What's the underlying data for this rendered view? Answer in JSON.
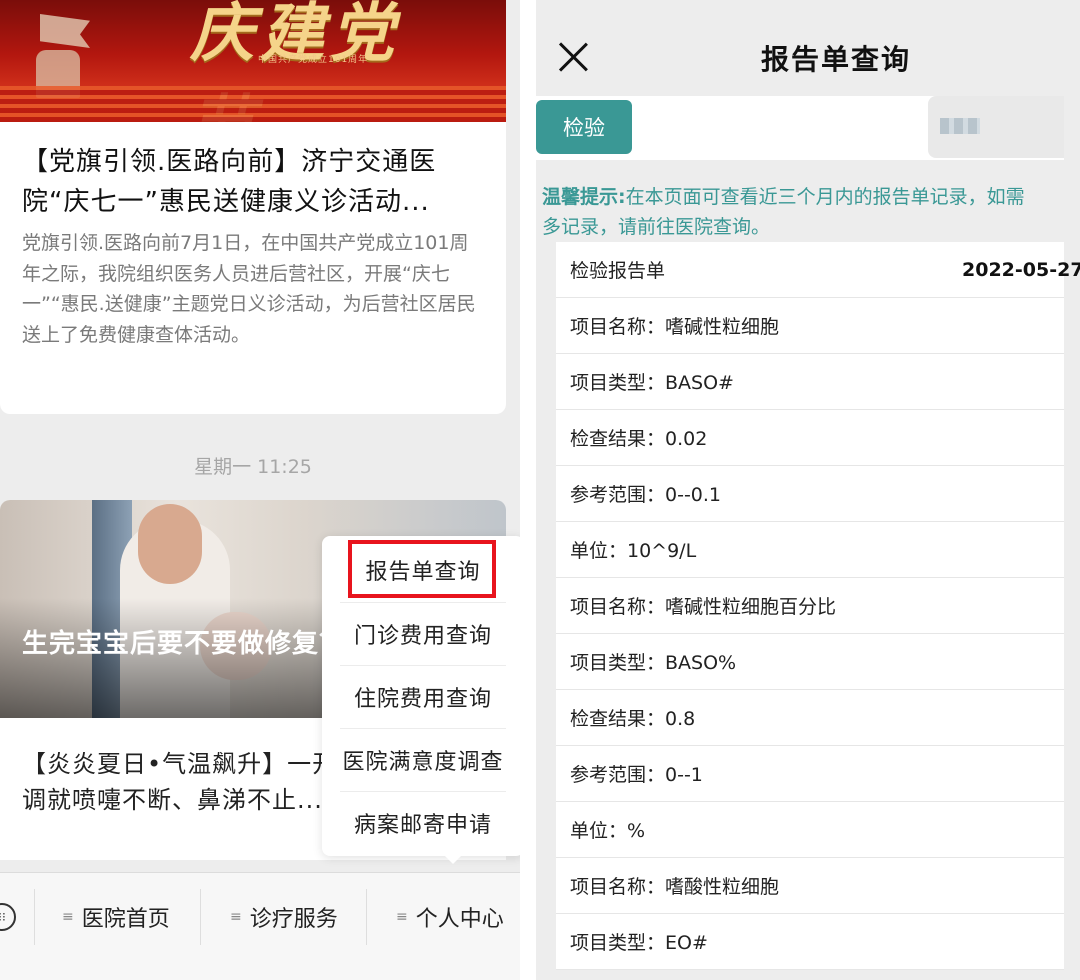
{
  "left": {
    "banner": {
      "headline": "庆建党节",
      "subtitle": "中国共产党成立101周年"
    },
    "article1": {
      "title": "【党旗引领.医路向前】济宁交通医院“庆七一”惠民送健康义诊活动...",
      "description": "党旗引领.医路向前7月1日，在中国共产党成立101周年之际，我院组织医务人员进后营社区，开展“庆七一”“惠民.送健康”主题党日义诊活动，为后营社区居民送上了免费健康查体活动。"
    },
    "timestamp": "星期一 11:25",
    "article2": {
      "overlay_title": "生完宝宝后要不要做修复？复的最佳时机，你知道吗",
      "title_line1": "【炎炎夏日•气温飙升】一开空",
      "title_line2": "调就喷嚏不断、鼻涕不止..."
    },
    "popup_menu": [
      "报告单查询",
      "门诊费用查询",
      "住院费用查询",
      "医院满意度调查",
      "病案邮寄申请"
    ],
    "bottom_nav": [
      "医院首页",
      "诊疗服务",
      "个人中心"
    ]
  },
  "right": {
    "title": "报告单查询",
    "tabs": {
      "active": "检验"
    },
    "notice_label": "温馨提示:",
    "notice_line1": "在本页面可查看近三个月内的报告单记录，如需",
    "notice_line2": "多记录，请前往医院查询。",
    "report_header": {
      "label": "检验报告单",
      "date": "2022-05-27"
    },
    "rows": [
      "项目名称：嗜碱性粒细胞",
      "项目类型：BASO#",
      "检查结果：0.02",
      "参考范围：0--0.1",
      "单位：10^9/L",
      "项目名称：嗜碱性粒细胞百分比",
      "项目类型：BASO%",
      "检查结果：0.8",
      "参考范围：0--1",
      "单位：%",
      "项目名称：嗜酸性粒细胞",
      "项目类型：EO#"
    ]
  },
  "colors": {
    "accent_teal": "#3a9895",
    "highlight_red": "#e8141d"
  }
}
